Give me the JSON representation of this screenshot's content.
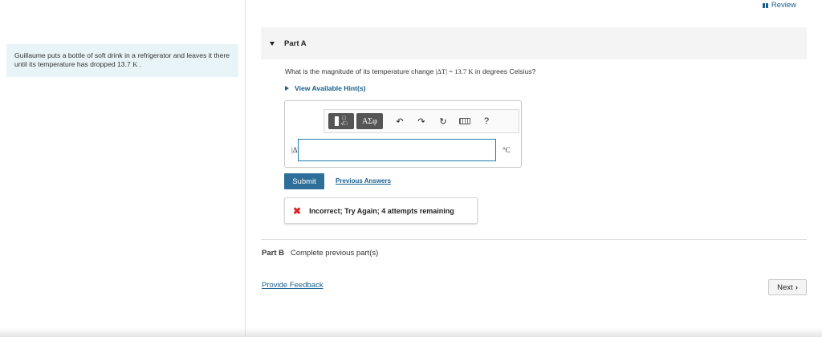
{
  "review": {
    "label": "Review"
  },
  "problem": {
    "text_before": "Guillaume puts a bottle of soft drink in a refrigerator and leaves it there until its temperature has dropped 13.7 ",
    "unit": "K",
    "text_after": " ."
  },
  "part_a": {
    "title": "Part A",
    "question_before": "What is the magnitude of its temperature change ",
    "question_math": "|ΔT| = 13.7 K",
    "question_after": " in degrees Celsius?",
    "hints_label": "View Available Hint(s)",
    "toolbar": {
      "symbols_label": "ΑΣφ",
      "help_label": "?",
      "icons": [
        "templates-icon",
        "greek-symbols-icon",
        "undo-icon",
        "redo-icon",
        "reset-icon",
        "keyboard-icon",
        "help-icon"
      ]
    },
    "answer_label": "|ΔT| =",
    "answer_value": "",
    "unit": "°C",
    "submit_label": "Submit",
    "previous_answers_label": "Previous Answers",
    "feedback": "Incorrect; Try Again; 4 attempts remaining"
  },
  "part_b": {
    "title": "Part B",
    "status": "Complete previous part(s)"
  },
  "footer": {
    "provide_feedback": "Provide Feedback",
    "next_label": "Next"
  },
  "colors": {
    "accent": "#1a5f8f",
    "submit": "#2d6f99",
    "problem_bg": "#e8f4f7",
    "error": "#dd2222"
  }
}
